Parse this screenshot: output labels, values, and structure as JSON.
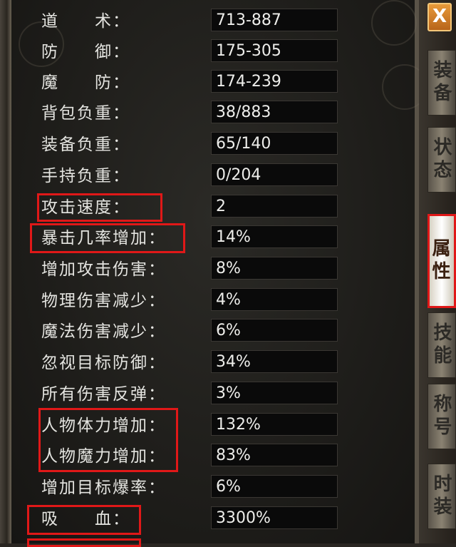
{
  "stats": [
    {
      "label": "道　　术：",
      "value": "713-887"
    },
    {
      "label": "防　　御：",
      "value": "175-305"
    },
    {
      "label": "魔　　防：",
      "value": "174-239"
    },
    {
      "label": "背包负重：",
      "value": "38/883"
    },
    {
      "label": "装备负重：",
      "value": "65/140"
    },
    {
      "label": "手持负重：",
      "value": "0/204"
    },
    {
      "label": "攻击速度：",
      "value": "2"
    },
    {
      "label": "暴击几率增加：",
      "value": "14%"
    },
    {
      "label": "增加攻击伤害：",
      "value": "8%"
    },
    {
      "label": "物理伤害减少：",
      "value": "4%"
    },
    {
      "label": "魔法伤害减少：",
      "value": "6%"
    },
    {
      "label": "忽视目标防御：",
      "value": "34%"
    },
    {
      "label": "所有伤害反弹：",
      "value": "3%"
    },
    {
      "label": "人物体力增加：",
      "value": "132%"
    },
    {
      "label": "人物魔力增加：",
      "value": "83%"
    },
    {
      "label": "增加目标爆率：",
      "value": "6%"
    },
    {
      "label": "吸　　血：",
      "value": "3300%"
    }
  ],
  "tabs": [
    {
      "label": "装备",
      "active": false
    },
    {
      "label": "状态",
      "active": false
    },
    {
      "label": "属性",
      "active": true
    },
    {
      "label": "技能",
      "active": false
    },
    {
      "label": "称号",
      "active": false
    },
    {
      "label": "时装",
      "active": false
    }
  ],
  "close_label": "X",
  "colors": {
    "highlight": "#e01818",
    "text": "#e4e4e0",
    "value_bg": "#0a0a0a"
  }
}
